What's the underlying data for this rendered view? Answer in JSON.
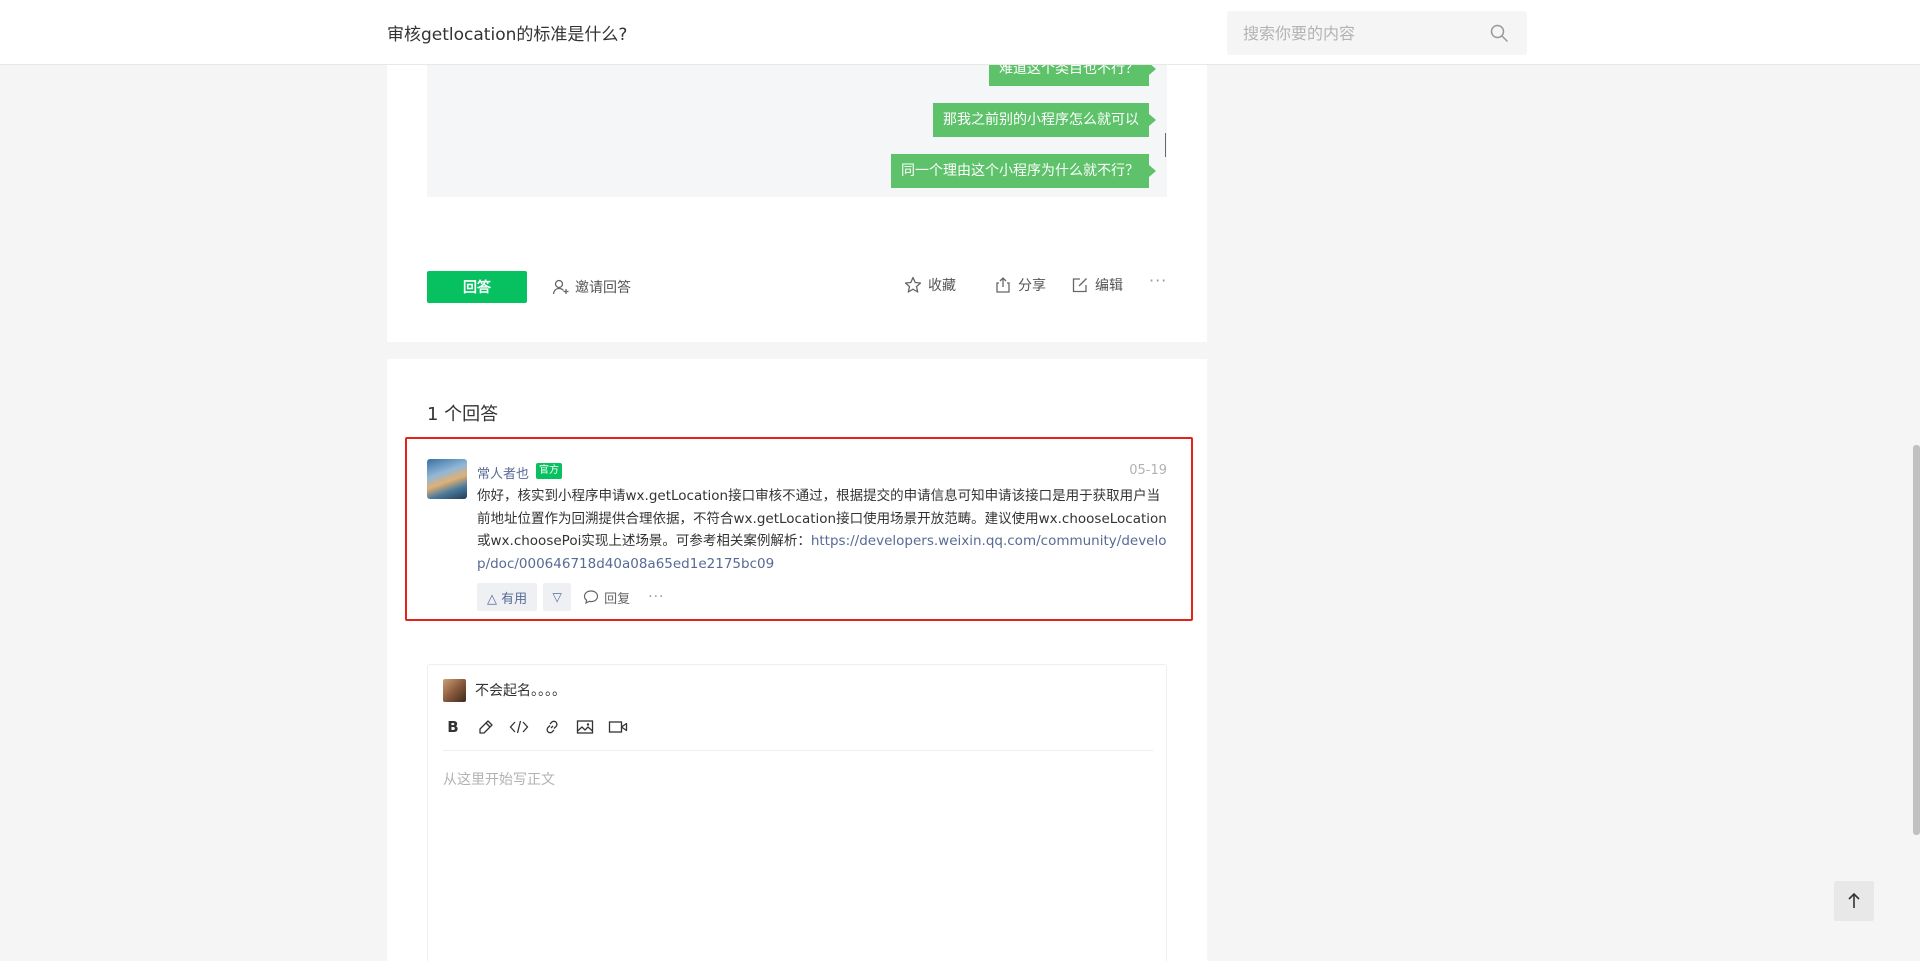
{
  "header": {
    "title": "审核getlocation的标准是什么?",
    "search_placeholder": "搜索你要的内容"
  },
  "question": {
    "messages": [
      "难道这个类目也不行？",
      "那我之前别的小程序怎么就可以",
      "同一个理由这个小程序为什么就不行？"
    ],
    "answer_label": "回答",
    "invite_label": "邀请回答",
    "favorite_label": "收藏",
    "share_label": "分享",
    "edit_label": "编辑",
    "more_label": "···"
  },
  "answers": {
    "count_label": "1 个回答",
    "items": [
      {
        "author": "常人者也",
        "badge": "官方",
        "date": "05-19",
        "body": "你好，核实到小程序申请wx.getLocation接口审核不通过，根据提交的申请信息可知申请该接口是用于获取用户当前地址位置作为回溯提供合理依据，不符合wx.getLocation接口使用场景开放范畴。建议使用wx.chooseLocation或wx.choosePoi实现上述场景。可参考相关案例解析：",
        "link": "https://developers.weixin.qq.com/community/develop/doc/000646718d40a08a65ed1e2175bc09",
        "useful_label": "△ 有用",
        "down_label": "▽",
        "reply_label": "回复",
        "more_label": "···"
      }
    ]
  },
  "editor": {
    "user_name": "不会起名。。。。",
    "bold_label": "B",
    "placeholder": "从这里开始写正文"
  },
  "colors": {
    "accent": "#07c160",
    "bubble": "#5dc26a",
    "link": "#576b95",
    "highlight_border": "#e5211a"
  }
}
